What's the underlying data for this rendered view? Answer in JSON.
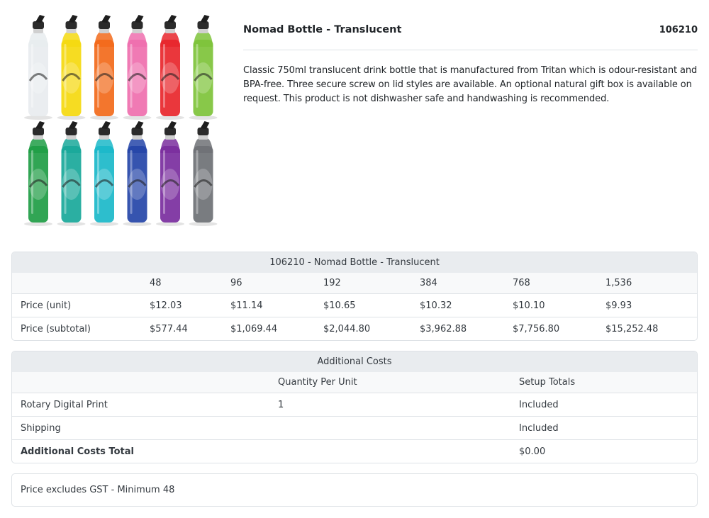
{
  "product": {
    "title": "Nomad Bottle - Translucent",
    "code": "106210",
    "description": "Classic 750ml translucent drink bottle that is manufactured from Tritan which is odour-resistant and BPA-free. Three secure screw on lid styles are available. An optional natural gift box is available on request. This product is not dishwasher safe and handwashing is recommended.",
    "image_icon": "bottle-collection-image"
  },
  "pricing": {
    "heading": "106210 - Nomad Bottle - Translucent",
    "quantities": [
      "48",
      "96",
      "192",
      "384",
      "768",
      "1,536"
    ],
    "rows": [
      {
        "label": "Price (unit)",
        "values": [
          "$12.03",
          "$11.14",
          "$10.65",
          "$10.32",
          "$10.10",
          "$9.93"
        ]
      },
      {
        "label": "Price (subtotal)",
        "values": [
          "$577.44",
          "$1,069.44",
          "$2,044.80",
          "$3,962.88",
          "$7,756.80",
          "$15,252.48"
        ]
      }
    ]
  },
  "additional_costs": {
    "heading": "Additional Costs",
    "columns": [
      "",
      "Quantity Per Unit",
      "Setup Totals"
    ],
    "rows": [
      {
        "label": "Rotary Digital Print",
        "quantity": "1",
        "setup": "Included"
      },
      {
        "label": "Shipping",
        "quantity": "",
        "setup": "Included"
      },
      {
        "label": "Additional Costs Total",
        "quantity": "",
        "setup": "$0.00"
      }
    ]
  },
  "note": "Price excludes GST - Minimum 48",
  "colors": {
    "border": "#dee2e6",
    "header_bg": "#e9ecef",
    "bottles_row1": [
      "#e8ecef",
      "#f5d90f",
      "#f26a1b",
      "#ef6fae",
      "#e8262b",
      "#7ec33a"
    ],
    "bottles_row2": [
      "#1f9d45",
      "#19a89a",
      "#1bb8c9",
      "#2545a8",
      "#7a2e9e",
      "#6e7175"
    ]
  }
}
